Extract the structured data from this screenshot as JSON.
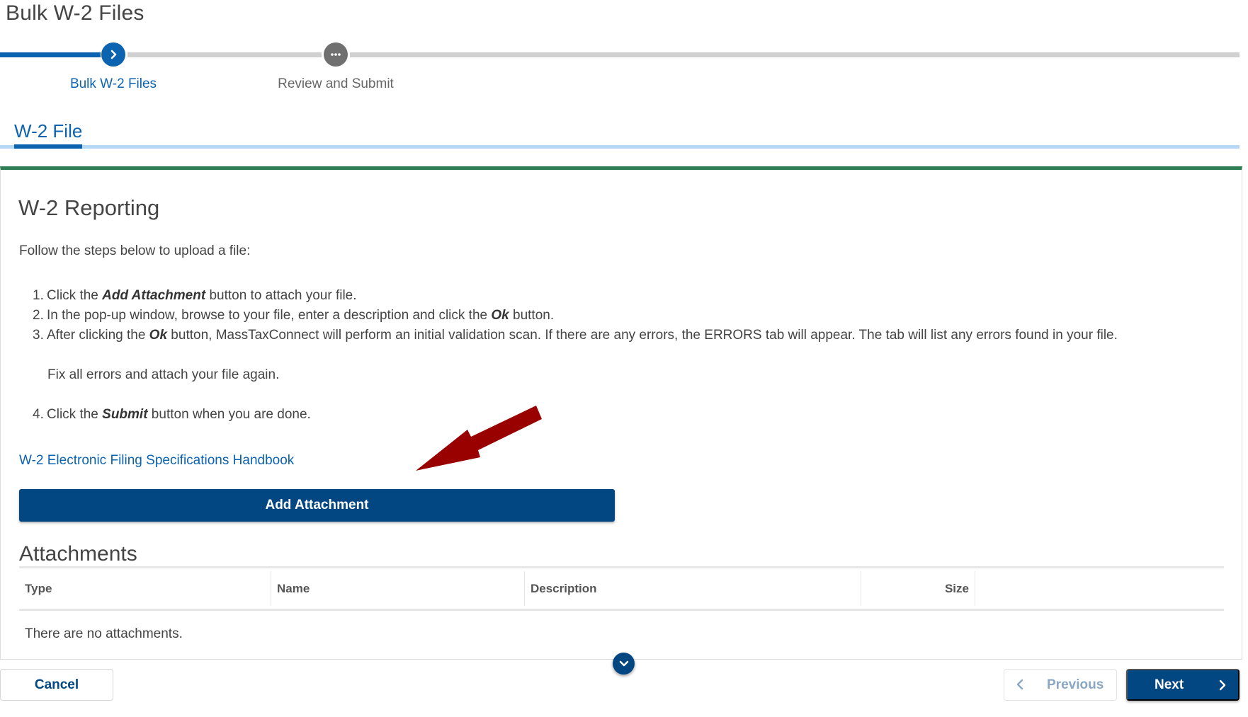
{
  "page": {
    "title": "Bulk W-2 Files"
  },
  "stepper": {
    "steps": [
      {
        "label": "Bulk W-2 Files",
        "state": "active",
        "icon": "chevron-right-icon"
      },
      {
        "label": "Review and Submit",
        "state": "pending",
        "icon": "ellipsis-icon"
      }
    ],
    "colors": {
      "active": "#0c63b0",
      "pending": "#707070",
      "track": "#d0d0d0"
    }
  },
  "tabs": [
    {
      "label": "W-2 File",
      "selected": true
    }
  ],
  "card": {
    "accent_color": "#2f7d52",
    "title": "W-2 Reporting",
    "intro": "Follow the steps below to upload a file:",
    "instructions": [
      {
        "num": "1.",
        "pre": "Click the ",
        "em": "Add Attachment",
        "post": " button to attach your file."
      },
      {
        "num": "2.",
        "pre": "In the pop-up window, browse to your file, enter a description and click the ",
        "em": "Ok",
        "post": " button."
      },
      {
        "num": "3.",
        "pre": "After clicking the ",
        "em": "Ok",
        "post": " button, MassTaxConnect will perform an initial validation scan. If there are any errors, the ERRORS tab will appear. The tab will list any errors found in your file."
      },
      {
        "note": "Fix all errors and attach your file again."
      },
      {
        "num": "4.",
        "pre": "Click the ",
        "em": "Submit",
        "post": " button when you are done."
      }
    ],
    "link": "W-2 Electronic Filing Specifications Handbook",
    "add_button": "Add Attachment",
    "annotation": {
      "type": "arrow",
      "color": "#990000",
      "points_to": "Add Attachment"
    }
  },
  "attachments": {
    "title": "Attachments",
    "columns": [
      "Type",
      "Name",
      "Description",
      "Size",
      ""
    ],
    "rows": [],
    "empty_message": "There are no attachments."
  },
  "footer": {
    "cancel": "Cancel",
    "previous": "Previous",
    "next": "Next",
    "primary_color": "#024781"
  }
}
